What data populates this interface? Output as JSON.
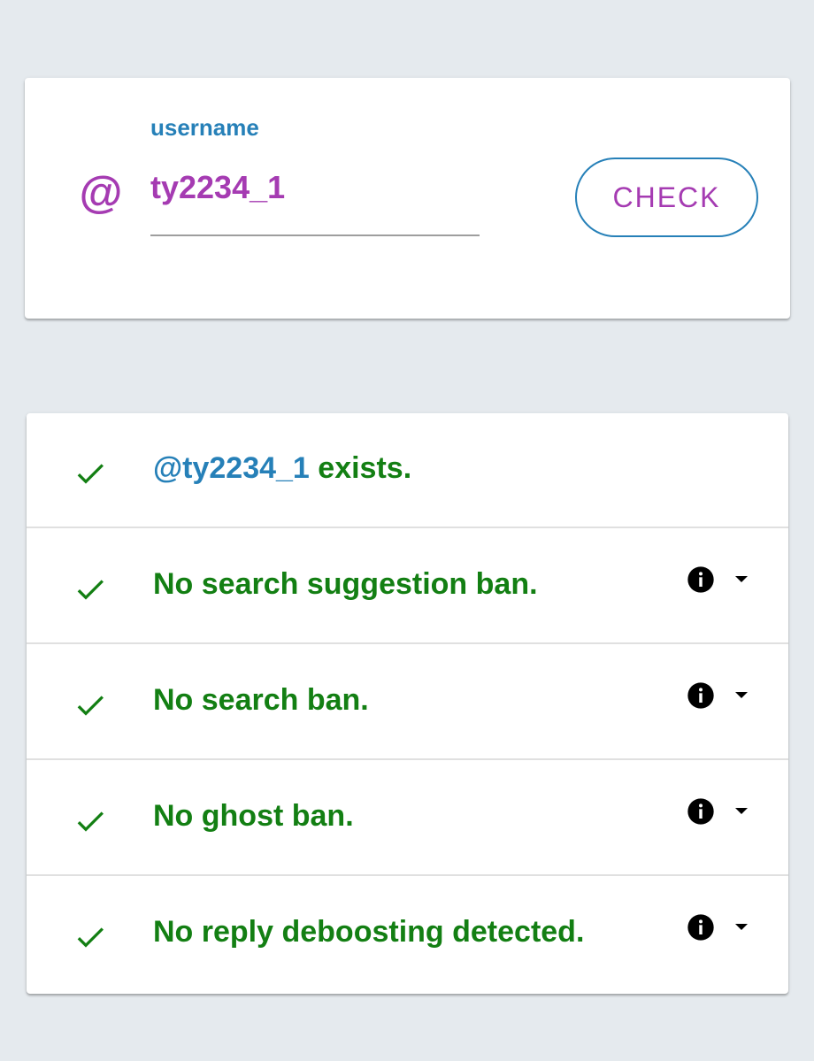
{
  "search": {
    "label": "username",
    "at_symbol": "@",
    "value": "ty2234_1",
    "check_label": "CHECK"
  },
  "results": {
    "items": [
      {
        "handle": "@ty2234_1",
        "text": " exists.",
        "status": "ok",
        "has_info": false
      },
      {
        "text": "No search suggestion ban.",
        "status": "ok",
        "has_info": true
      },
      {
        "text": "No search ban.",
        "status": "ok",
        "has_info": true
      },
      {
        "text": "No ghost ban.",
        "status": "ok",
        "has_info": true
      },
      {
        "text": "No reply deboosting detected.",
        "status": "ok",
        "has_info": true
      }
    ]
  },
  "colors": {
    "accent_purple": "#a53bb2",
    "accent_blue": "#2680b8",
    "success_green": "#137f13",
    "background": "#e5eaee"
  },
  "icons": {
    "check": "check-icon",
    "info": "info-icon",
    "caret": "caret-down-icon"
  }
}
